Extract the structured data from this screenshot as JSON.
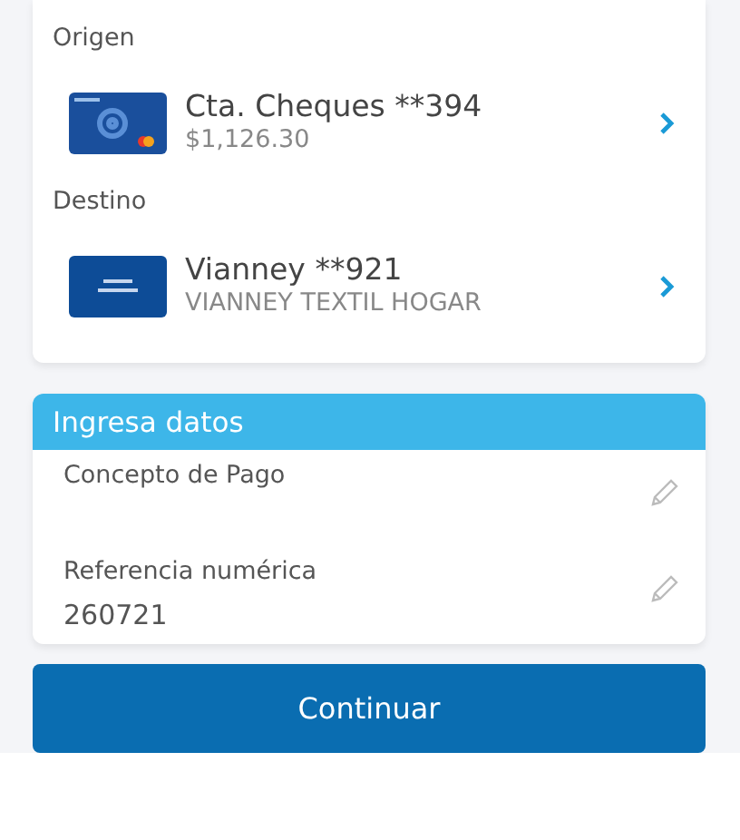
{
  "transfer": {
    "sections": [
      {
        "label": "Origen",
        "account": {
          "kind": "debit_card",
          "name": "Cta. Cheques **394",
          "detail": "$1,126.30"
        }
      },
      {
        "label": "Destino",
        "account": {
          "kind": "bank_logo",
          "name": "Vianney **921",
          "detail": "VIANNEY TEXTIL HOGAR"
        }
      }
    ]
  },
  "form": {
    "title": "Ingresa datos",
    "fields": [
      {
        "label": "Concepto de Pago"
      },
      {
        "label": "Referencia numérica",
        "value": "260721"
      }
    ]
  },
  "primary_button": {
    "label": "Continuar"
  }
}
